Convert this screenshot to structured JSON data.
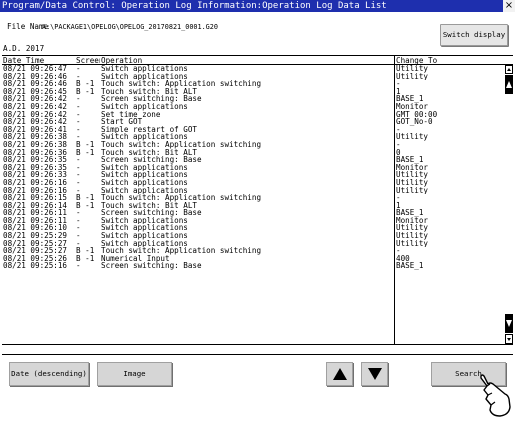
{
  "window": {
    "title": "Program/Data Control: Operation Log Information:Operation Log Data List",
    "close_glyph": "×"
  },
  "header": {
    "file_label": "File Name",
    "file_value": "A:\\PACKAGE1\\OPELOG\\OPELOG_20170821_0001.G20",
    "year": "A.D. 2017",
    "switch_display_label": "Switch display"
  },
  "table": {
    "columns": {
      "datetime": "Date  Time",
      "screen": "Screen No.",
      "operation": "Operation",
      "change_to": "Change To"
    },
    "rows": [
      {
        "datetime": "08/21 09:26:47",
        "screen": "-",
        "operation": "Switch applications",
        "change_to": "Utility"
      },
      {
        "datetime": "08/21 09:26:46",
        "screen": "-",
        "operation": "Switch applications",
        "change_to": "Utility"
      },
      {
        "datetime": "08/21 09:26:46",
        "screen": "B -1",
        "operation": "Touch switch: Application switching",
        "change_to": "-"
      },
      {
        "datetime": "08/21 09:26:45",
        "screen": "B -1",
        "operation": "Touch switch: Bit ALT",
        "change_to": "1"
      },
      {
        "datetime": "08/21 09:26:42",
        "screen": "-",
        "operation": "Screen switching: Base",
        "change_to": "BASE_1"
      },
      {
        "datetime": "08/21 09:26:42",
        "screen": "-",
        "operation": "Switch applications",
        "change_to": "Monitor"
      },
      {
        "datetime": "08/21 09:26:42",
        "screen": "-",
        "operation": "Set time zone",
        "change_to": "GMT 00:00"
      },
      {
        "datetime": "08/21 09:26:42",
        "screen": "-",
        "operation": "Start GOT",
        "change_to": "GOT_No-0"
      },
      {
        "datetime": "08/21 09:26:41",
        "screen": "-",
        "operation": "Simple restart of GOT",
        "change_to": "-"
      },
      {
        "datetime": "08/21 09:26:38",
        "screen": "-",
        "operation": "Switch applications",
        "change_to": "Utility"
      },
      {
        "datetime": "08/21 09:26:38",
        "screen": "B -1",
        "operation": "Touch switch: Application switching",
        "change_to": "-"
      },
      {
        "datetime": "08/21 09:26:36",
        "screen": "B -1",
        "operation": "Touch switch: Bit ALT",
        "change_to": "0"
      },
      {
        "datetime": "08/21 09:26:35",
        "screen": "-",
        "operation": "Screen switching: Base",
        "change_to": "BASE_1"
      },
      {
        "datetime": "08/21 09:26:35",
        "screen": "-",
        "operation": "Switch applications",
        "change_to": "Monitor"
      },
      {
        "datetime": "08/21 09:26:33",
        "screen": "-",
        "operation": "Switch applications",
        "change_to": "Utility"
      },
      {
        "datetime": "08/21 09:26:16",
        "screen": "-",
        "operation": "Switch applications",
        "change_to": "Utility"
      },
      {
        "datetime": "08/21 09:26:16",
        "screen": "-",
        "operation": "Switch applications",
        "change_to": "Utility"
      },
      {
        "datetime": "08/21 09:26:15",
        "screen": "B -1",
        "operation": "Touch switch: Application switching",
        "change_to": "-"
      },
      {
        "datetime": "08/21 09:26:14",
        "screen": "B -1",
        "operation": "Touch switch: Bit ALT",
        "change_to": "1"
      },
      {
        "datetime": "08/21 09:26:11",
        "screen": "-",
        "operation": "Screen switching: Base",
        "change_to": "BASE_1"
      },
      {
        "datetime": "08/21 09:26:11",
        "screen": "-",
        "operation": "Switch applications",
        "change_to": "Monitor"
      },
      {
        "datetime": "08/21 09:26:10",
        "screen": "-",
        "operation": "Switch applications",
        "change_to": "Utility"
      },
      {
        "datetime": "08/21 09:25:29",
        "screen": "-",
        "operation": "Switch applications",
        "change_to": "Utility"
      },
      {
        "datetime": "08/21 09:25:27",
        "screen": "-",
        "operation": "Switch applications",
        "change_to": "Utility"
      },
      {
        "datetime": "08/21 09:25:27",
        "screen": "B -1",
        "operation": "Touch switch: Application switching",
        "change_to": "-"
      },
      {
        "datetime": "08/21 09:25:26",
        "screen": "B -1",
        "operation": "Numerical Input",
        "change_to": "400"
      },
      {
        "datetime": "08/21 09:25:16",
        "screen": "-",
        "operation": "Screen switching: Base",
        "change_to": "BASE_1"
      }
    ]
  },
  "buttons": {
    "date_label": "Date (descending)",
    "image_label": "Image",
    "search_label": "Search",
    "scroll_up_icon": "triangle-up",
    "scroll_down_icon": "triangle-down"
  },
  "colors": {
    "titlebar": "#1e2fae",
    "button_face": "#d6d6d6"
  }
}
